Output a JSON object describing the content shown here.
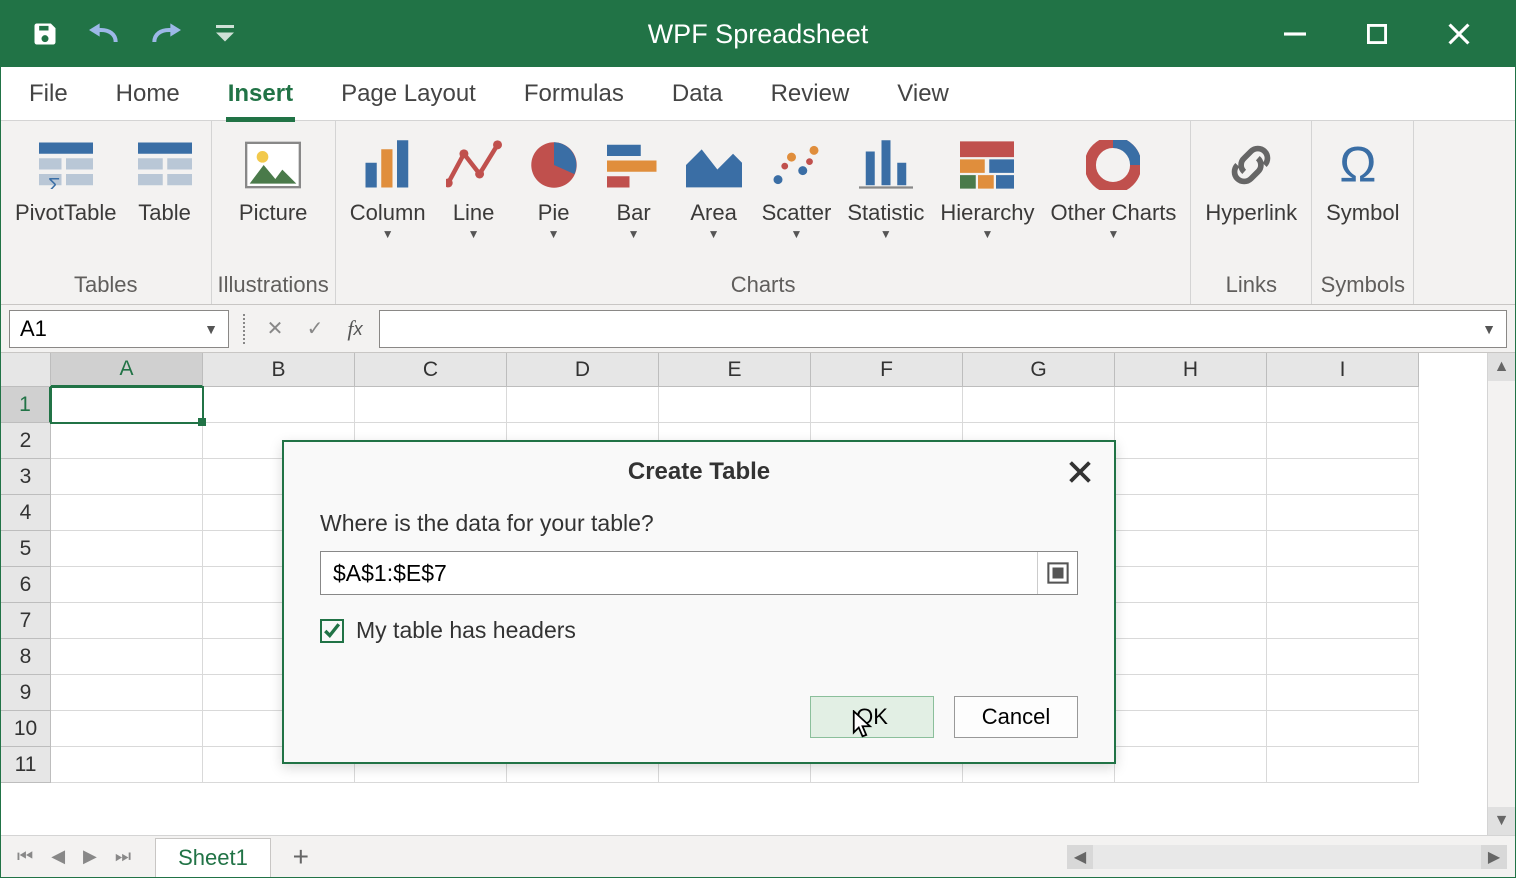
{
  "app": {
    "title": "WPF Spreadsheet"
  },
  "ribbon_tabs": [
    "File",
    "Home",
    "Insert",
    "Page Layout",
    "Formulas",
    "Data",
    "Review",
    "View"
  ],
  "active_tab": "Insert",
  "ribbon": {
    "groups": [
      {
        "title": "Tables",
        "buttons": [
          {
            "label": "PivotTable",
            "icon": "pivottable",
            "dd": false
          },
          {
            "label": "Table",
            "icon": "table",
            "dd": false
          }
        ]
      },
      {
        "title": "Illustrations",
        "buttons": [
          {
            "label": "Picture",
            "icon": "picture",
            "dd": false
          }
        ]
      },
      {
        "title": "Charts",
        "buttons": [
          {
            "label": "Column",
            "icon": "column-chart",
            "dd": true
          },
          {
            "label": "Line",
            "icon": "line-chart",
            "dd": true
          },
          {
            "label": "Pie",
            "icon": "pie-chart",
            "dd": true
          },
          {
            "label": "Bar",
            "icon": "bar-chart",
            "dd": true
          },
          {
            "label": "Area",
            "icon": "area-chart",
            "dd": true
          },
          {
            "label": "Scatter",
            "icon": "scatter-chart",
            "dd": true
          },
          {
            "label": "Statistic",
            "icon": "statistic-chart",
            "dd": true
          },
          {
            "label": "Hierarchy",
            "icon": "hierarchy-chart",
            "dd": true
          },
          {
            "label": "Other Charts",
            "icon": "other-charts",
            "dd": true
          }
        ]
      },
      {
        "title": "Links",
        "buttons": [
          {
            "label": "Hyperlink",
            "icon": "hyperlink",
            "dd": false
          }
        ]
      },
      {
        "title": "Symbols",
        "buttons": [
          {
            "label": "Symbol",
            "icon": "symbol",
            "dd": false
          }
        ]
      }
    ]
  },
  "name_box": "A1",
  "formula": "",
  "columns": [
    "A",
    "B",
    "C",
    "D",
    "E",
    "F",
    "G",
    "H",
    "I"
  ],
  "rows": [
    "1",
    "2",
    "3",
    "4",
    "5",
    "6",
    "7",
    "8",
    "9",
    "10",
    "11"
  ],
  "active_cell": "A1",
  "sheets": [
    "Sheet1"
  ],
  "active_sheet": "Sheet1",
  "dialog": {
    "title": "Create Table",
    "prompt": "Where is the data for your table?",
    "range": "$A$1:$E$7",
    "headers_label": "My table has headers",
    "headers_checked": true,
    "ok": "OK",
    "cancel": "Cancel"
  }
}
